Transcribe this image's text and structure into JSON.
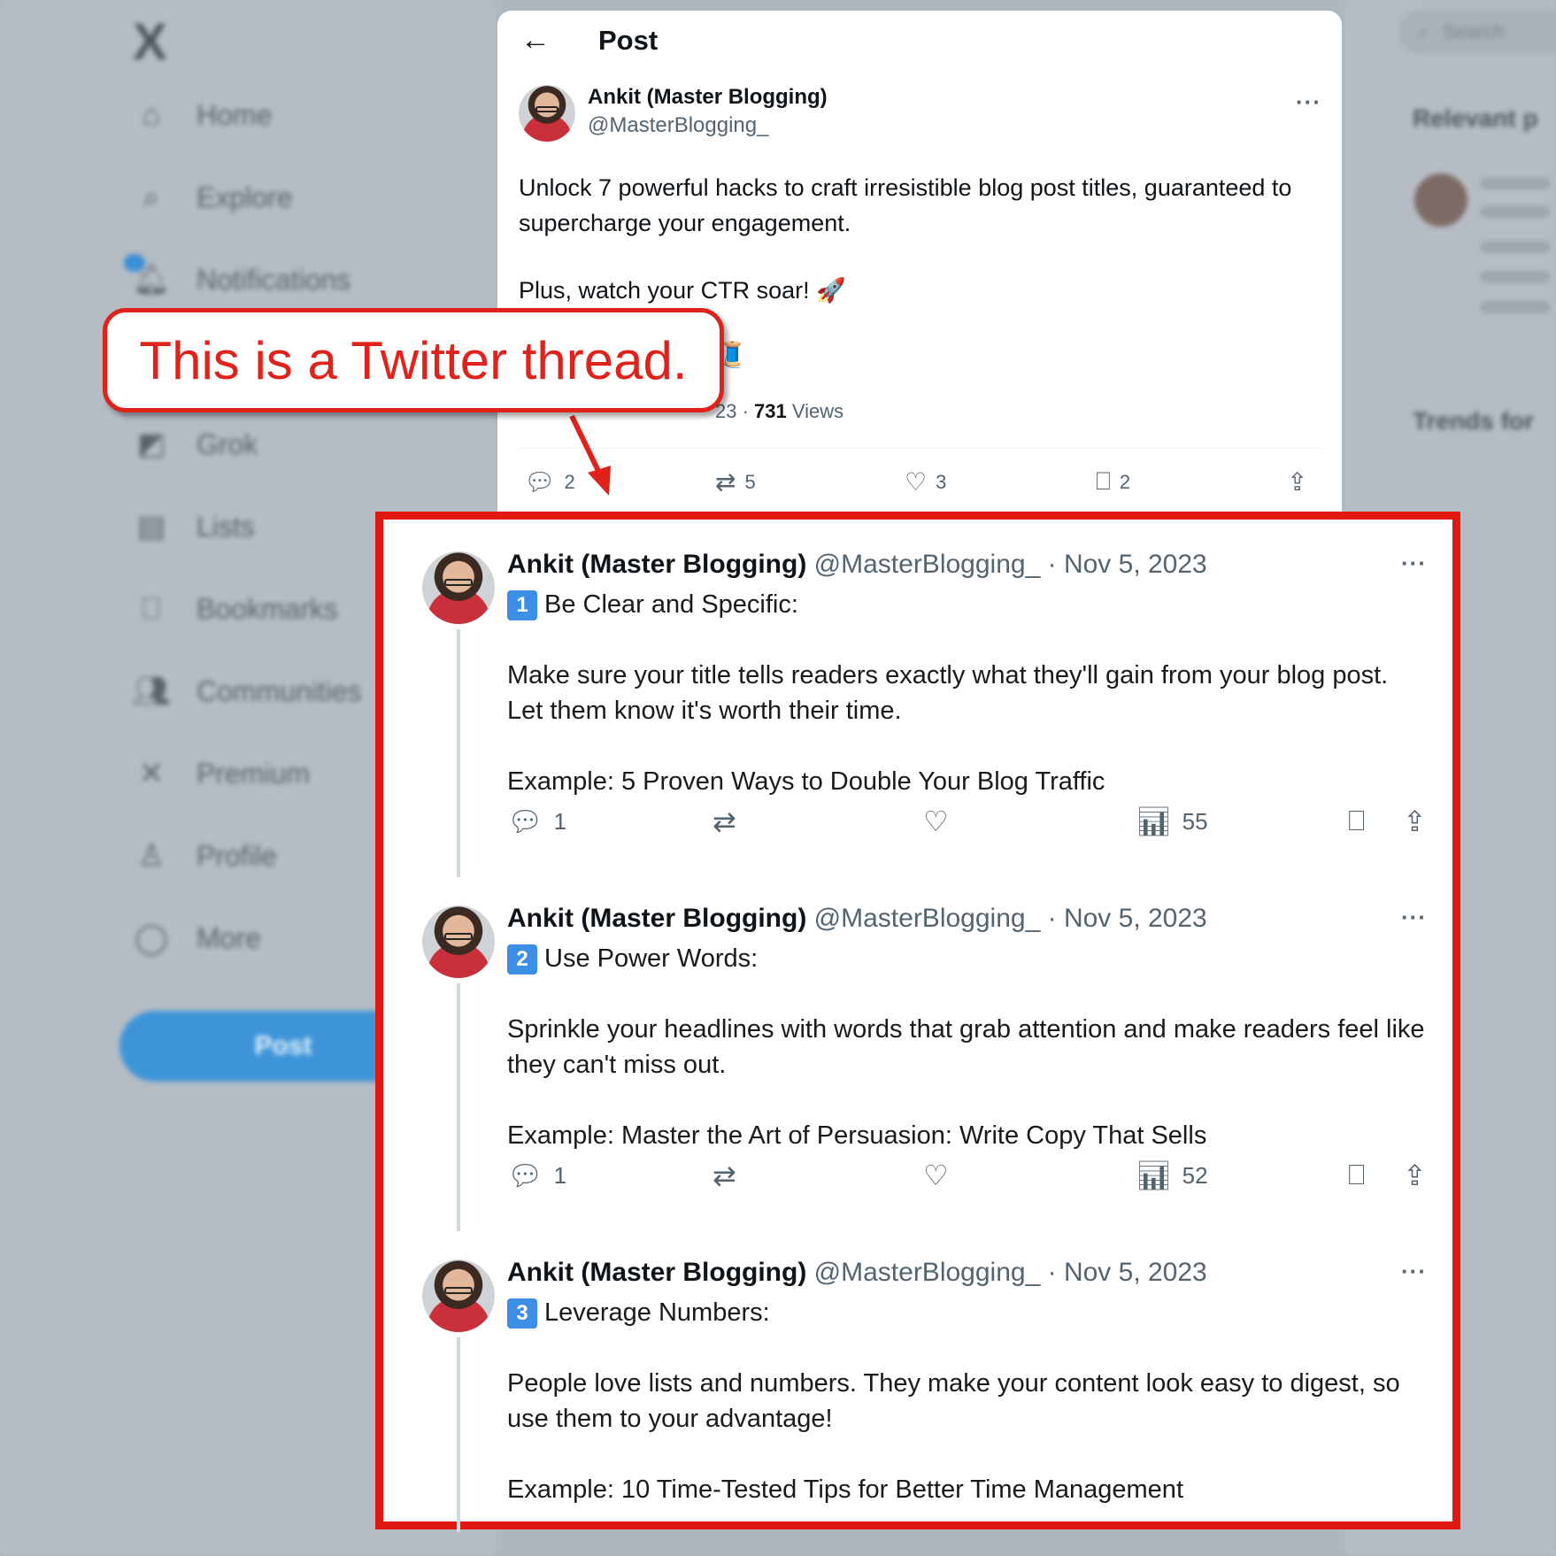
{
  "sidebar": {
    "logo": "X",
    "items": [
      {
        "label": "Home",
        "icon": "home-icon"
      },
      {
        "label": "Explore",
        "icon": "search-icon"
      },
      {
        "label": "Notifications",
        "icon": "bell-icon"
      },
      {
        "label": "Grok",
        "icon": "grok-icon"
      },
      {
        "label": "Lists",
        "icon": "list-icon"
      },
      {
        "label": "Bookmarks",
        "icon": "bookmark-icon"
      },
      {
        "label": "Communities",
        "icon": "communities-icon"
      },
      {
        "label": "Premium",
        "icon": "x-icon"
      },
      {
        "label": "Profile",
        "icon": "profile-icon"
      },
      {
        "label": "More",
        "icon": "more-icon"
      }
    ],
    "post_button": "Post"
  },
  "right": {
    "search_placeholder": "Search",
    "relevant_title": "Relevant p",
    "trends_title": "Trends for"
  },
  "post": {
    "header_title": "Post",
    "author_name": "Ankit (Master Blogging)",
    "author_handle": "@MasterBlogging_",
    "text_line1": "Unlock 7 powerful hacks to craft irresistible blog post titles, guaranteed to supercharge your engagement.",
    "text_line2": "Plus, watch your CTR soar! 🚀",
    "meta_prefix": "23 · ",
    "views_count": "731",
    "views_label": " Views",
    "actions": {
      "replies": "2",
      "reposts": "5",
      "likes": "3",
      "bookmarks": "2"
    }
  },
  "callout": {
    "text": "This is a Twitter thread."
  },
  "thread": [
    {
      "name": "Ankit (Master Blogging)",
      "handle": "@MasterBlogging_",
      "date": "Nov 5, 2023",
      "num": "1",
      "heading": "Be Clear and Specific:",
      "body": "Make sure your title tells readers exactly what they'll gain from your blog post. Let them know it's worth their time.",
      "example": "Example: 5 Proven Ways to Double Your Blog Traffic",
      "replies": "1",
      "views": "55"
    },
    {
      "name": "Ankit (Master Blogging)",
      "handle": "@MasterBlogging_",
      "date": "Nov 5, 2023",
      "num": "2",
      "heading": "Use Power Words:",
      "body": "Sprinkle your headlines with words that grab attention and make readers feel like they can't miss out.",
      "example": "Example: Master the Art of Persuasion: Write Copy That Sells",
      "replies": "1",
      "views": "52"
    },
    {
      "name": "Ankit (Master Blogging)",
      "handle": "@MasterBlogging_",
      "date": "Nov 5, 2023",
      "num": "3",
      "heading": "Leverage Numbers:",
      "body": "People love lists and numbers. They make your content look easy to digest, so use them to your advantage!",
      "example": "Example: 10 Time-Tested Tips for Better Time Management"
    }
  ],
  "colors": {
    "accent_red": "#e0221a",
    "brand_blue": "#1d9bf0",
    "number_badge": "#3c8ee6"
  }
}
